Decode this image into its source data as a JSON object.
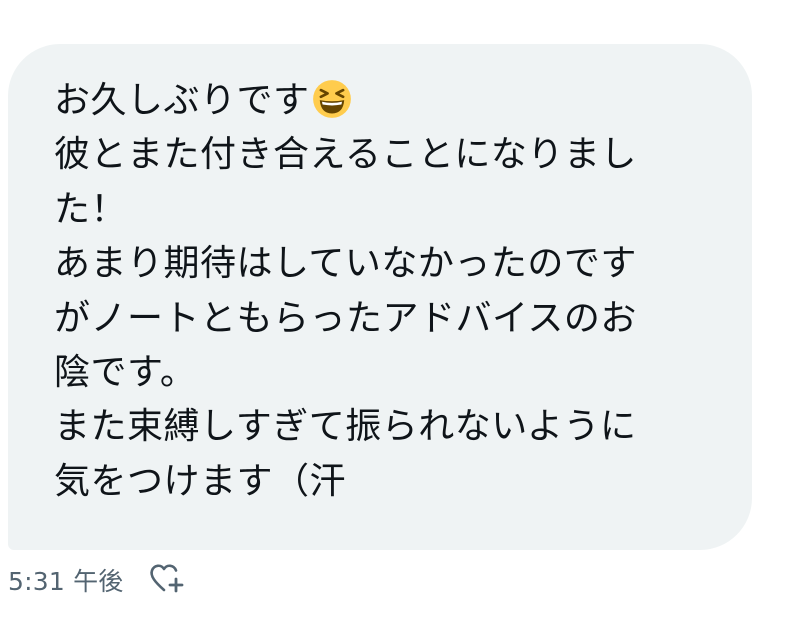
{
  "message": {
    "lines": [
      "お久しぶりです",
      "彼とまた付き合えることになりまし",
      "た！",
      "あまり期待はしていなかったのです",
      "がノートともらったアドバイスのお",
      "陰です。",
      "また束縛しすぎて振られないように",
      "気をつけます（汗"
    ],
    "emoji": "grinning-squinting-face-icon"
  },
  "meta": {
    "timestamp": "5:31 午後",
    "reaction_icon": "heart-plus-icon"
  },
  "colors": {
    "bubble_bg": "#eff3f4",
    "text": "#0f1419",
    "muted": "#536471",
    "emoji_face": "#ffcc4d",
    "emoji_feature": "#664500"
  }
}
